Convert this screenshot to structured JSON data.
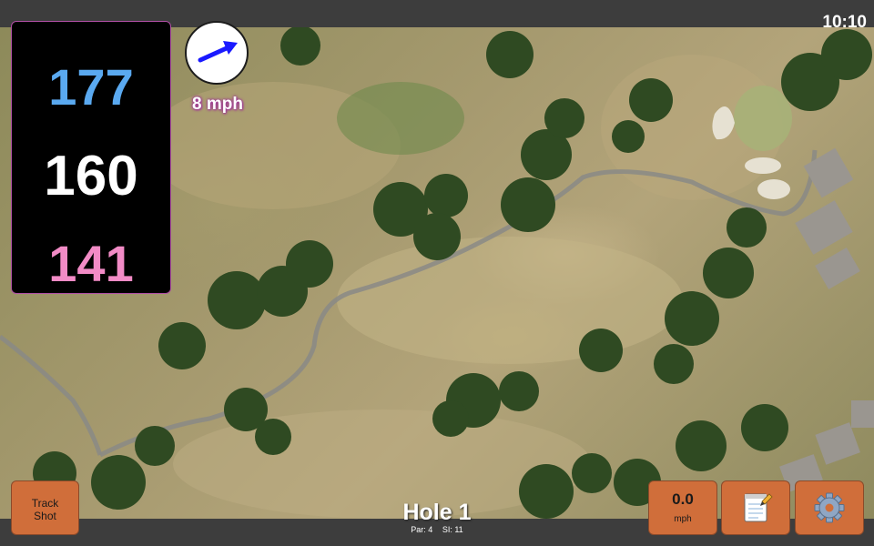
{
  "status": {
    "time": "10:10"
  },
  "yardages": {
    "back": "177",
    "middle": "160",
    "front": "141"
  },
  "wind": {
    "speed_label": "8 mph",
    "arrow_color": "#1a1aff"
  },
  "hole": {
    "title": "Hole 1",
    "par_label": "Par: 4",
    "si_label": "SI: 11"
  },
  "buttons": {
    "track_shot": [
      "Track",
      "Shot"
    ],
    "speed_value": "0.0",
    "speed_unit": "mph",
    "notes_icon": "notepad-icon",
    "settings_icon": "gear-icon"
  },
  "colors": {
    "back_yardage": "#5aa9f0",
    "middle_yardage": "#ffffff",
    "front_yardage": "#f28bc6",
    "button_bg": "#d06e3a"
  }
}
